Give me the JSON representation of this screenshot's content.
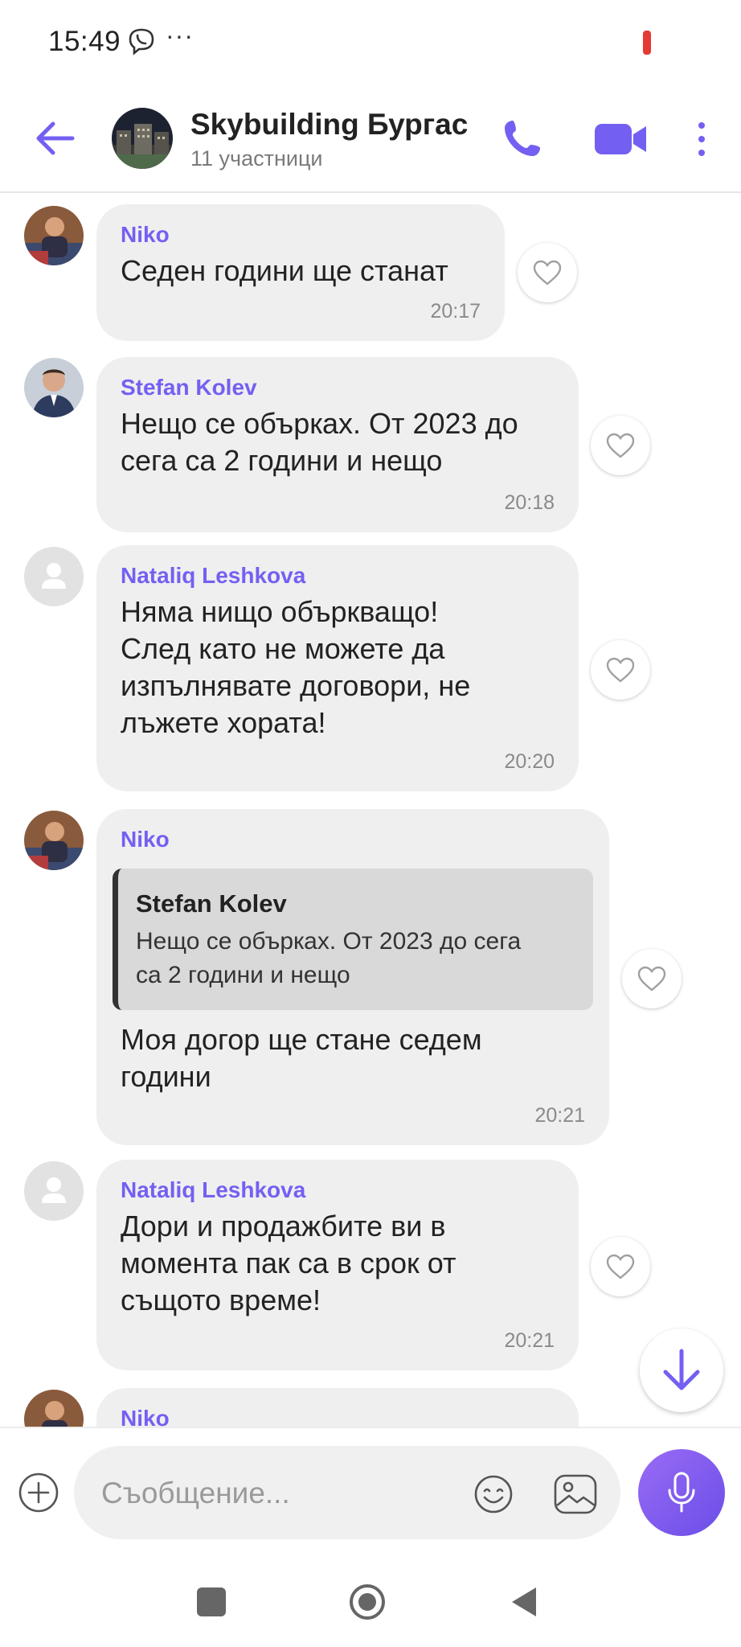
{
  "status_bar": {
    "time": "15:49",
    "dots": "···"
  },
  "header": {
    "title": "Skybuilding Бургас",
    "subtitle": "11 участници"
  },
  "messages": [
    {
      "sender": "Niko",
      "text": "Седен години ще станат",
      "time": "20:17",
      "avatar": "niko"
    },
    {
      "sender": "Stefan Kolev",
      "text": "Нещо се объркax. От 2023 до\nсега са 2 години и нещо",
      "time": "20:18",
      "avatar": "stefan"
    },
    {
      "sender": "Nataliq Leshkova",
      "text": "Няма нищо объркващо!\nСлед като не можете да\nизпълнявате договори, не\nлъжете хората!",
      "time": "20:20",
      "avatar": "default"
    },
    {
      "sender": "Niko",
      "quote": {
        "sender": "Stefan Kolev",
        "text": "Нещо се объркax. От 2023 до сега\nса 2 години и нещо"
      },
      "text": "Моя догор ще стане седем\nгодини",
      "time": "20:21",
      "avatar": "niko"
    },
    {
      "sender": "Nataliq Leshkova",
      "text": "Дори и продажбите ви в\nмомента пак са в срок от\nсъщото време!",
      "time": "20:21",
      "avatar": "default"
    },
    {
      "sender": "Niko",
      "avatar": "niko"
    }
  ],
  "composer": {
    "placeholder": "Съобщение..."
  },
  "colors": {
    "accent": "#7360f2",
    "bubble": "#efefef",
    "sender": "#7360f2"
  }
}
